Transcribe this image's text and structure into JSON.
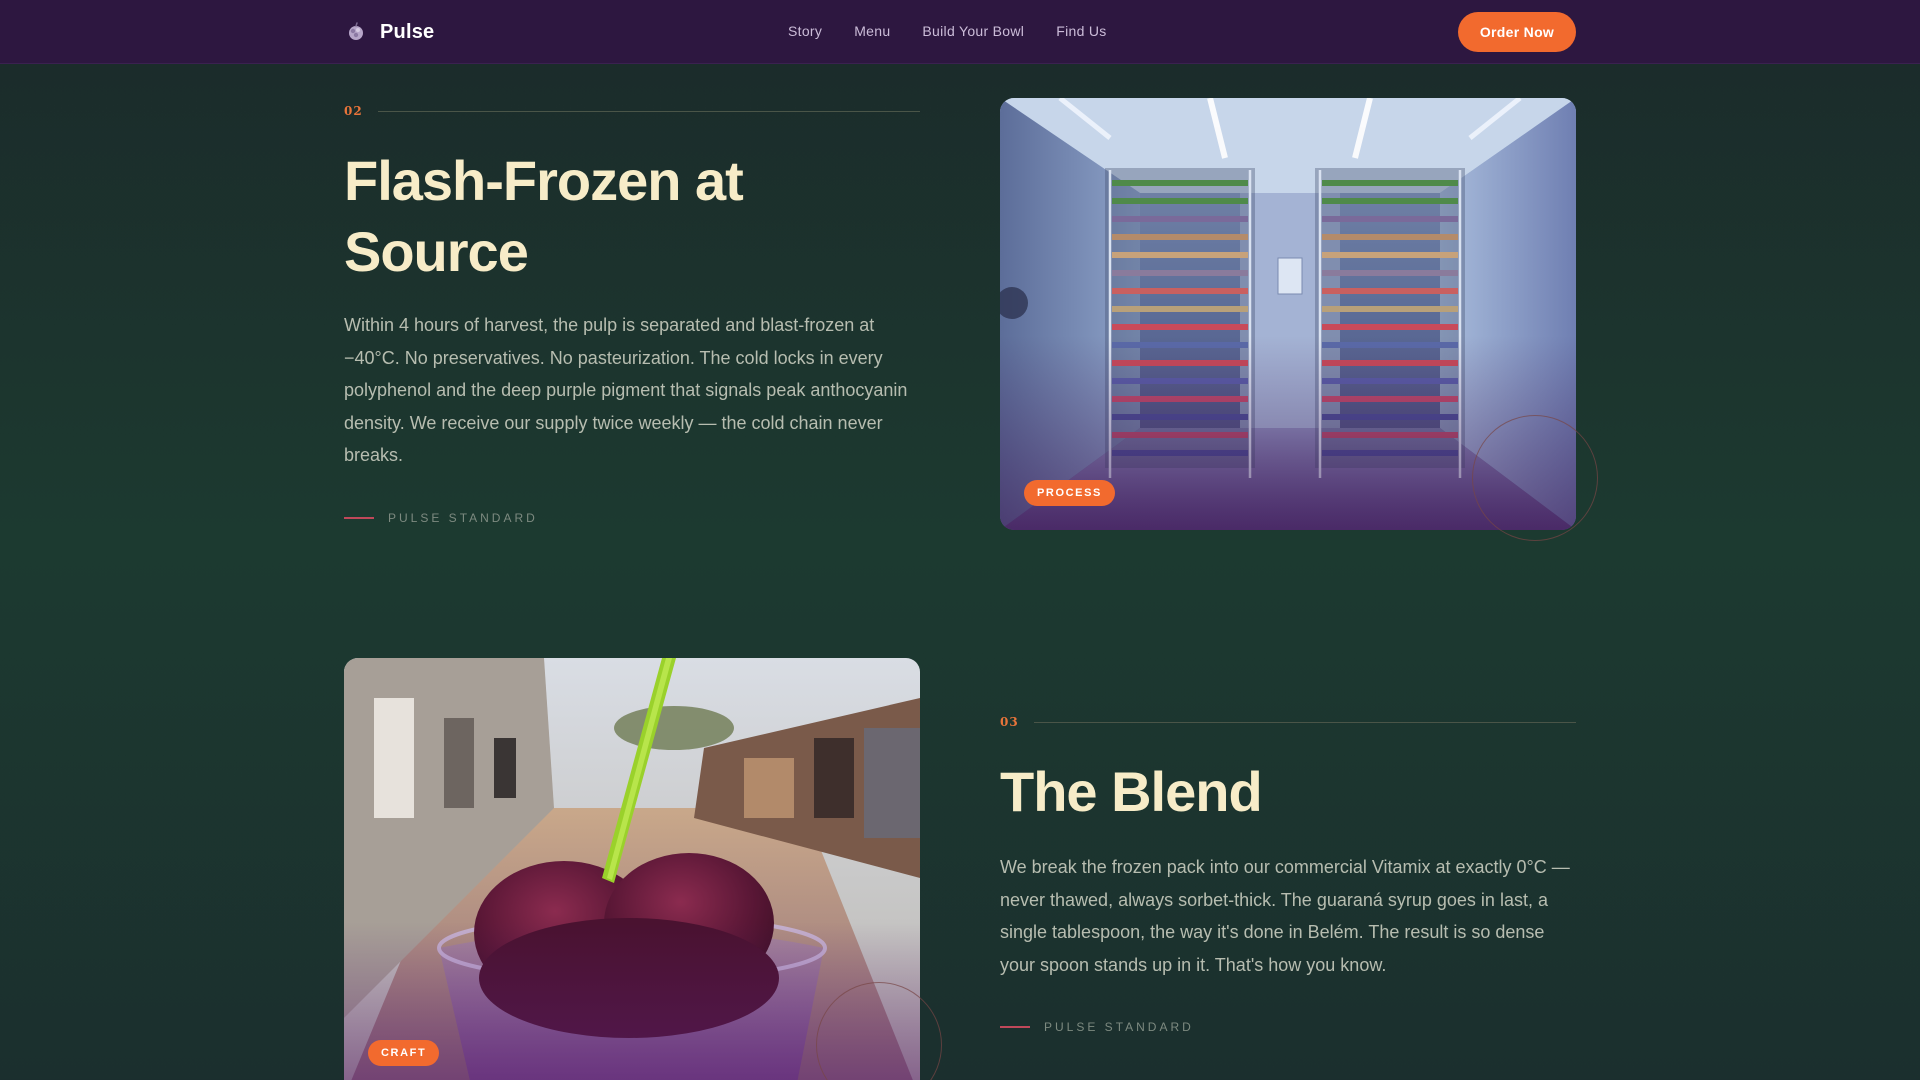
{
  "brand": {
    "name": "Pulse",
    "icon": "acai-berry-icon"
  },
  "nav": {
    "links": [
      "Story",
      "Menu",
      "Build Your Bowl",
      "Find Us"
    ],
    "cta": "Order Now"
  },
  "sections": [
    {
      "number": "02",
      "title_line1": "Flash-Frozen at",
      "title_line2": "Source",
      "body": "Within 4 hours of harvest, the pulp is separated and blast-frozen at −40°C. No preservatives. No pasteurization. The cold locks in every polyphenol and the deep purple pigment that signals peak anthocyanin density. We receive our supply twice weekly — the cold chain never breaks.",
      "standard": "PULSE STANDARD",
      "image_badge": "PROCESS",
      "image": "cold-storage-freezer-room-photo"
    },
    {
      "number": "03",
      "title": "The Blend",
      "body": "We break the frozen pack into our commercial Vitamix at exactly 0°C — never thawed, always sorbet-thick. The guaraná syrup goes in last, a single tablespoon, the way it's done in Belém. The result is so dense your spoon stands up in it. That's how you know.",
      "standard": "PULSE STANDARD",
      "image_badge": "CRAFT",
      "image": "acai-cup-street-photo"
    }
  ],
  "colors": {
    "nav_bg": "#2d1740",
    "accent": "#f26a2e",
    "heading": "#f7ecc8",
    "body_text": "#b7bdb0",
    "section_number": "#e8743a"
  }
}
